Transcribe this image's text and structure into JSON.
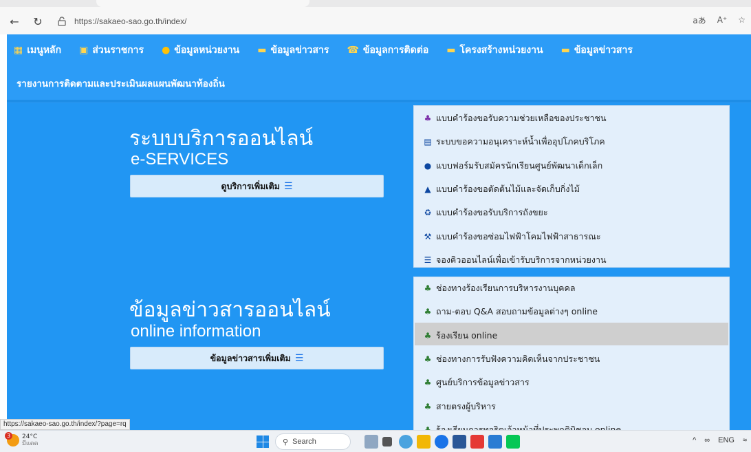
{
  "browser": {
    "url": "https://sakaeo-sao.go.th/index/",
    "right_icons": [
      "aあ",
      "A⁺",
      "☆"
    ]
  },
  "nav": {
    "items": [
      {
        "label": "เมนูหลัก",
        "icon": "grid-icon",
        "color": "#ffd54f"
      },
      {
        "label": "ส่วนราชการ",
        "icon": "calendar-icon",
        "color": "#ffd54f"
      },
      {
        "label": "ข้อมูลหน่วยงาน",
        "icon": "info-icon",
        "color": "#ffc107"
      },
      {
        "label": "ข้อมูลข่าวสาร",
        "icon": "chat-icon",
        "color": "#ffd54f"
      },
      {
        "label": "ข้อมูลการติดต่อ",
        "icon": "phone-icon",
        "color": "#ffd54f"
      },
      {
        "label": "โครงสร้างหน่วยงาน",
        "icon": "folder-icon",
        "color": "#ffd54f"
      },
      {
        "label": "ข้อมูลข่าวสาร",
        "icon": "chat-icon",
        "color": "#ffd54f"
      }
    ],
    "row2": "รายงานการติดตามและประเมินผลแผนพัฒนาท้องถิ่น"
  },
  "eservices": {
    "title": "ระบบบริการออนไลน์",
    "subtitle": "e-SERVICES",
    "button": "ดูบริการเพิ่มเติม",
    "items": [
      {
        "label": "แบบคำร้องขอรับความช่วยเหลือของประชาชน",
        "icon": "users-icon",
        "color": "#7b2fa8"
      },
      {
        "label": "ระบบขอความอนุเคราะห์น้ำเพื่ออุปโภคบริโภค",
        "icon": "id-card-icon",
        "color": "#0d47a1"
      },
      {
        "label": "แบบฟอร์มรับสมัครนักเรียนศูนย์พัฒนาเด็กเล็ก",
        "icon": "comment-icon",
        "color": "#0d47a1"
      },
      {
        "label": "แบบคำร้องขอตัดต้นไม้และจัดเก็บกิ่งไม้",
        "icon": "tree-icon",
        "color": "#0d47a1"
      },
      {
        "label": "แบบคำร้องขอรับบริการถังขยะ",
        "icon": "recycle-icon",
        "color": "#0d47a1"
      },
      {
        "label": "แบบคำร้องขอซ่อมไฟฟ้าโคมไฟฟ้าสาธารณะ",
        "icon": "wrench-icon",
        "color": "#0d47a1"
      },
      {
        "label": "จองคิวออนไลน์เพื่อเข้ารับบริการจากหน่วยงาน",
        "icon": "list-icon",
        "color": "#0d47a1"
      }
    ]
  },
  "information": {
    "title": "ข้อมูลข่าวสารออนไลน์",
    "subtitle": "online information",
    "button": "ข้อมูลข่าวสารเพิ่มเติม",
    "items": [
      {
        "label": "ช่องทางร้องเรียนการบริหารงานบุคคล",
        "icon": "users-icon",
        "color": "#2e7d32"
      },
      {
        "label": "ถาม-ตอบ Q&A สอบถามข้อมูลต่างๆ online",
        "icon": "users-icon",
        "color": "#2e7d32"
      },
      {
        "label": "ร้องเรียน online",
        "icon": "users-icon",
        "color": "#2e7d32",
        "highlighted": true
      },
      {
        "label": "ช่องทางการรับฟังความคิดเห็นจากประชาชน",
        "icon": "users-icon",
        "color": "#2e7d32"
      },
      {
        "label": "ศูนย์บริการข้อมูลข่าวสาร",
        "icon": "users-icon",
        "color": "#2e7d32"
      },
      {
        "label": "สายตรงผู้บริหาร",
        "icon": "users-icon",
        "color": "#2e7d32"
      },
      {
        "label": "ร้องเรียนการทุจริตเจ้าหน้าที่ประพฤติมิชอบ online",
        "icon": "users-icon",
        "color": "#2e7d32"
      }
    ]
  },
  "status_url": "https://sakaeo-sao.go.th/index/?page=rq",
  "taskbar": {
    "weather_badge": "3",
    "weather_temp": "24°C",
    "weather_desc": "มีแดด",
    "search": "Search",
    "tray_lang": "ENG"
  }
}
